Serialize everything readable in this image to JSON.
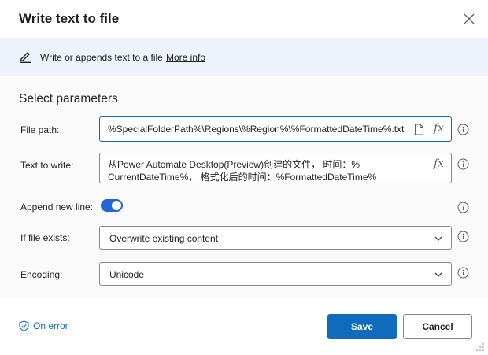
{
  "dialog": {
    "title": "Write text to file"
  },
  "banner": {
    "description": "Write or appends text to a file",
    "link": "More info"
  },
  "parameters": {
    "section_title": "Select parameters",
    "file_path": {
      "label": "File path:",
      "value": "%SpecialFolderPath%\\Regions\\%Region%\\%FormattedDateTime%.txt"
    },
    "text_to_write": {
      "label": "Text to write:",
      "line1": "从Power Automate Desktop(Preview)创建的文件， 时间：%",
      "line2": "CurrentDateTime%， 格式化后的时间：%FormattedDateTime%"
    },
    "append_new_line": {
      "label": "Append new line:",
      "enabled": true
    },
    "if_file_exists": {
      "label": "If file exists:",
      "value": "Overwrite existing content"
    },
    "encoding": {
      "label": "Encoding:",
      "value": "Unicode"
    },
    "fx_label": "fx"
  },
  "footer": {
    "on_error": "On error",
    "save": "Save",
    "cancel": "Cancel"
  },
  "colors": {
    "accent": "#0f6cbd",
    "toggle_on": "#2266d8",
    "banner_bg": "#eef2fa"
  }
}
